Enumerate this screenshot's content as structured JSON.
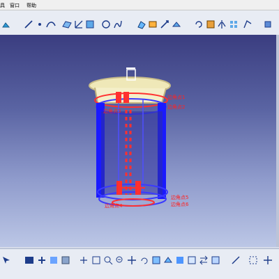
{
  "menu": {
    "items": [
      "具",
      "窗口",
      "帮助"
    ]
  },
  "model_labels": {
    "top_right_1": "边角点1",
    "top_right_2": "边角点2",
    "left_top": "边角点3",
    "bottom_right_1": "边角点5",
    "bottom_right_2": "边角点6",
    "bottom_left": "边角点4"
  },
  "icons": {
    "top_row": [
      "sketch",
      "line",
      "dot",
      "curve",
      "plane",
      "axis",
      "fill",
      "split",
      "join",
      "intersect",
      "project",
      "circle",
      "spline",
      "surface",
      "repair",
      "translate",
      "transform",
      "rotate",
      "scale",
      "mirror",
      "pattern",
      "offset",
      "extrude",
      "revolve",
      "sweep",
      "loft",
      "spring",
      "cut",
      "point",
      "measure"
    ],
    "bottom_row": [
      "selection",
      "visual",
      "tree",
      "sketch-mode",
      "display",
      "fly",
      "fit",
      "zoom-in",
      "zoom-out",
      "pan",
      "rotate-view",
      "normal-view",
      "iso-view",
      "shading",
      "hide",
      "swap",
      "show",
      "cut-view",
      "select-box",
      "explode",
      "stop"
    ]
  }
}
